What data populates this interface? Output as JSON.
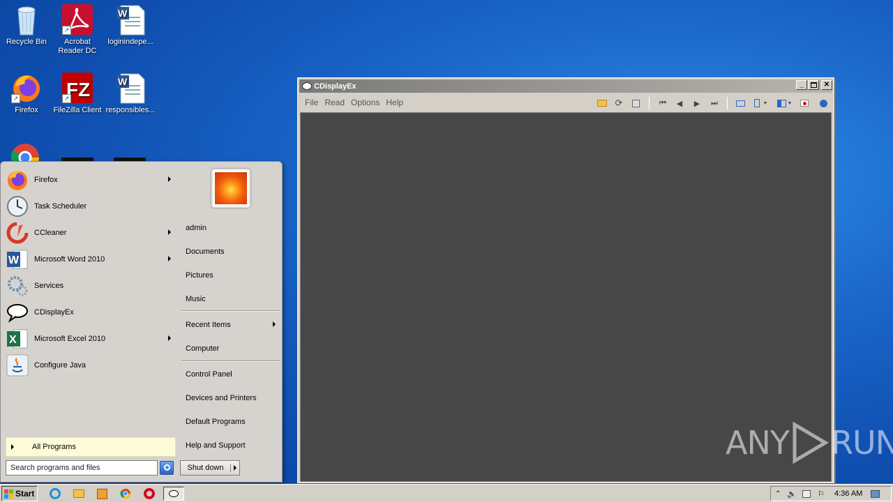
{
  "desktop": {
    "icons": [
      {
        "label": "Recycle Bin"
      },
      {
        "label": "Acrobat Reader DC"
      },
      {
        "label": "loginindepe..."
      },
      {
        "label": "Firefox"
      },
      {
        "label": "FileZilla Client"
      },
      {
        "label": "responsibles..."
      }
    ]
  },
  "start_menu": {
    "programs": [
      {
        "label": "Firefox",
        "submenu": true
      },
      {
        "label": "Task Scheduler",
        "submenu": false
      },
      {
        "label": "CCleaner",
        "submenu": true
      },
      {
        "label": "Microsoft Word 2010",
        "submenu": true
      },
      {
        "label": "Services",
        "submenu": false
      },
      {
        "label": "CDisplayEx",
        "submenu": false
      },
      {
        "label": "Microsoft Excel 2010",
        "submenu": true
      },
      {
        "label": "Configure Java",
        "submenu": false
      }
    ],
    "all_programs": "All Programs",
    "search_placeholder": "Search programs and files",
    "places": [
      "admin",
      "Documents",
      "Pictures",
      "Music",
      "Recent Items",
      "Computer",
      "Control Panel",
      "Devices and Printers",
      "Default Programs",
      "Help and Support"
    ],
    "shutdown_label": "Shut down"
  },
  "window": {
    "title": "CDisplayEx",
    "menu": [
      "File",
      "Read",
      "Options",
      "Help"
    ]
  },
  "taskbar": {
    "start_label": "Start",
    "clock": "4:36 AM"
  },
  "watermark": {
    "text_left": "ANY",
    "text_right": "RUN"
  },
  "colors": {
    "viewer_bg": "#474747",
    "desktop_blue": "#1a66c9",
    "start_menu_bg": "#d6d3ce"
  }
}
